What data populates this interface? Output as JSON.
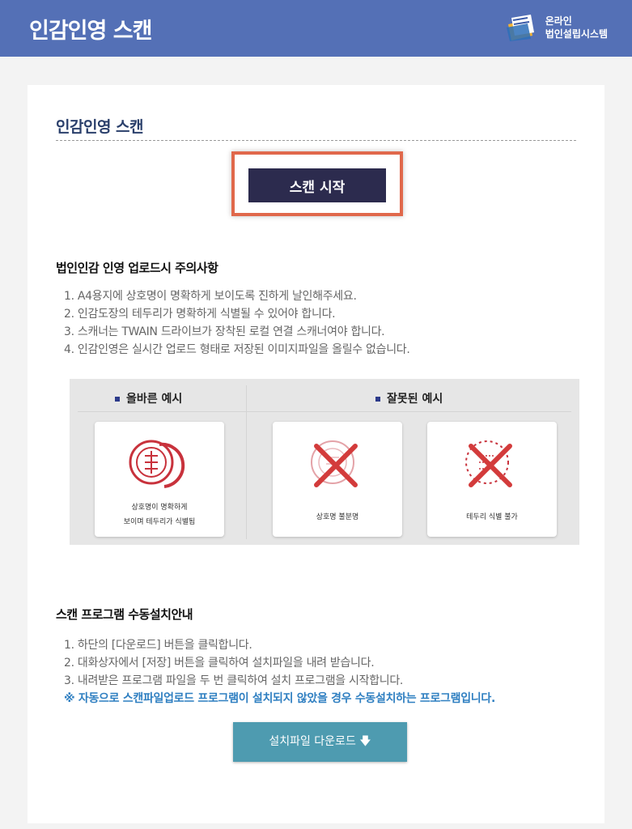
{
  "header": {
    "title": "인감인영 스캔",
    "brand_line1": "온라인",
    "brand_line2": "법인설립시스템"
  },
  "main": {
    "section_title": "인감인영 스캔",
    "scan_button": "스캔 시작",
    "caution_title": "법인인감 인영 업로드시 주의사항",
    "caution_items": [
      "1. A4용지에 상호명이 명확하게 보이도록 진하게 날인해주세요.",
      "2. 인감도장의 테두리가 명확하게 식별될 수 있어야 합니다.",
      "3. 스캐너는 TWAIN 드라이브가 장착된 로컬 연결 스캐너여야 합니다.",
      "4. 인감인영은 실시간 업로드 형태로 저장된 이미지파일을 올릴수 없습니다."
    ],
    "examples": {
      "correct_heading": "올바른 예시",
      "wrong_heading": "잘못된 예시",
      "correct_caption_line1": "상호명이 명확하게",
      "correct_caption_line2": "보이며 테두리가 식별됨",
      "wrong1_caption": "상호명 불분명",
      "wrong2_caption": "테두리 식별 불가"
    },
    "install_title": "스캔 프로그램 수동설치안내",
    "install_items": [
      "1. 하단의 [다운로드] 버튼을 클릭합니다.",
      "2. 대화상자에서 [저장] 버튼을 클릭하여 설치파일을 내려 받습니다.",
      "3. 내려받은 프로그램 파일을 두 번 클릭하여 설치 프로그램을 시작합니다."
    ],
    "install_notice": "※ 자동으로 스캔파일업로드 프로그램이 설치되지 않았을 경우 수동설치하는 프로그램입니다.",
    "download_button": "설치파일 다운로드 🡇"
  },
  "colors": {
    "header_bg": "#5470b6",
    "scan_button_bg": "#2c2b4e",
    "highlight_frame": "#e0684b",
    "notice": "#2f7fc1",
    "download_bg": "#4e9bb0",
    "stamp": "#c8323c"
  },
  "icons": {
    "brand_logo": "folder-document-icon",
    "correct_stamp": "seal-stamp-icon",
    "wrong_mark": "x-mark-icon",
    "download": "arrow-down-icon"
  }
}
